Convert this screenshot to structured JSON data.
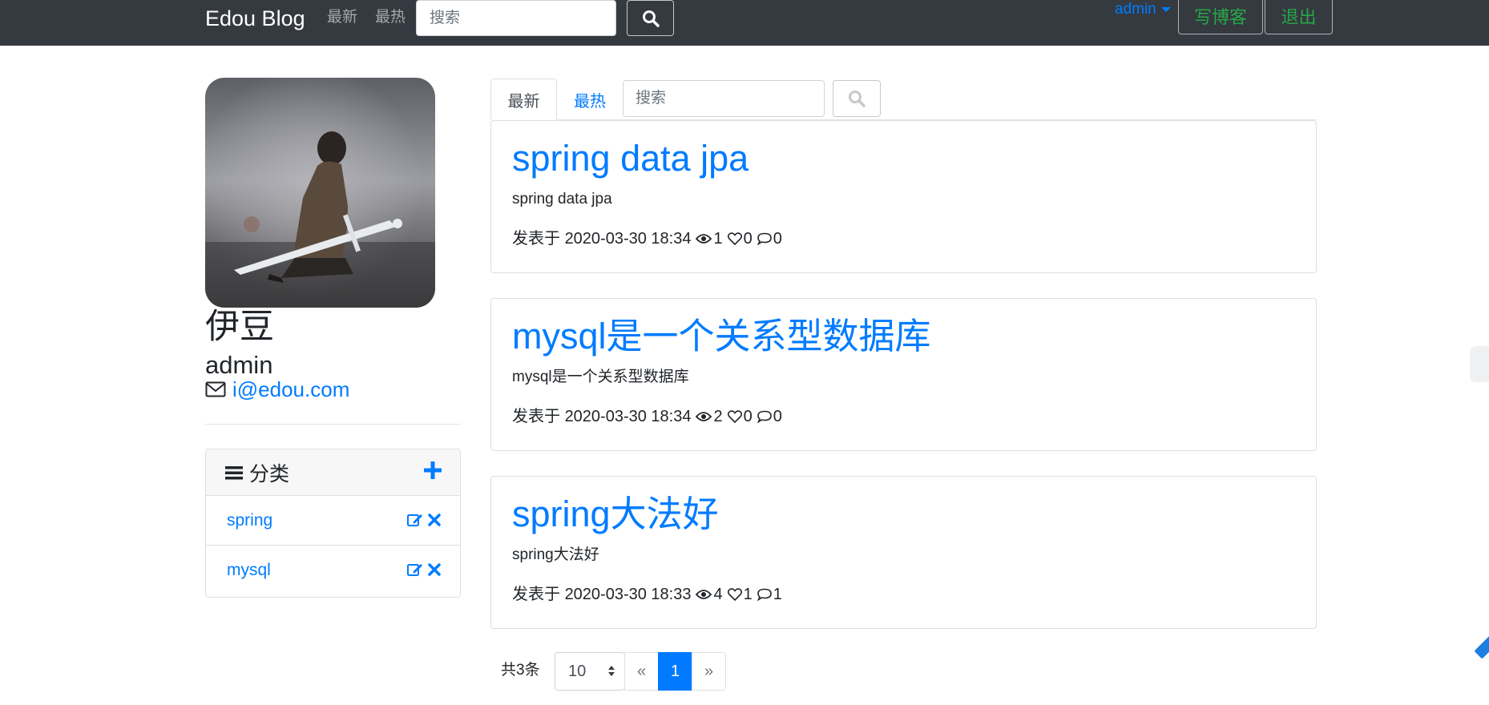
{
  "navbar": {
    "brand": "Edou Blog",
    "links": [
      "最新",
      "最热"
    ],
    "search_placeholder": "搜索",
    "user_label": "admin",
    "write_button": "写博客",
    "logout_button": "退出"
  },
  "profile": {
    "nickname": "伊豆",
    "username": "admin",
    "email": "i@edou.com"
  },
  "categories": {
    "title": "分类",
    "items": [
      {
        "name": "spring"
      },
      {
        "name": "mysql"
      }
    ]
  },
  "tabs": {
    "latest": "最新",
    "hottest": "最热",
    "search_placeholder": "搜索"
  },
  "posts": [
    {
      "title": "spring data jpa",
      "summary": "spring data jpa",
      "published_prefix": "发表于",
      "date": "2020-03-30 18:34",
      "views": "1",
      "likes": "0",
      "comments": "0"
    },
    {
      "title": "mysql是一个关系型数据库",
      "summary": "mysql是一个关系型数据库",
      "published_prefix": "发表于",
      "date": "2020-03-30 18:34",
      "views": "2",
      "likes": "0",
      "comments": "0"
    },
    {
      "title": "spring大法好",
      "summary": "spring大法好",
      "published_prefix": "发表于",
      "date": "2020-03-30 18:33",
      "views": "4",
      "likes": "1",
      "comments": "1"
    }
  ],
  "pagination": {
    "total_label": "共3条",
    "page_size": "10",
    "prev": "«",
    "current": "1",
    "next": "»"
  },
  "colors": {
    "navbar_bg": "#343a40",
    "link_blue": "#007bff",
    "success_green": "#28a745"
  }
}
